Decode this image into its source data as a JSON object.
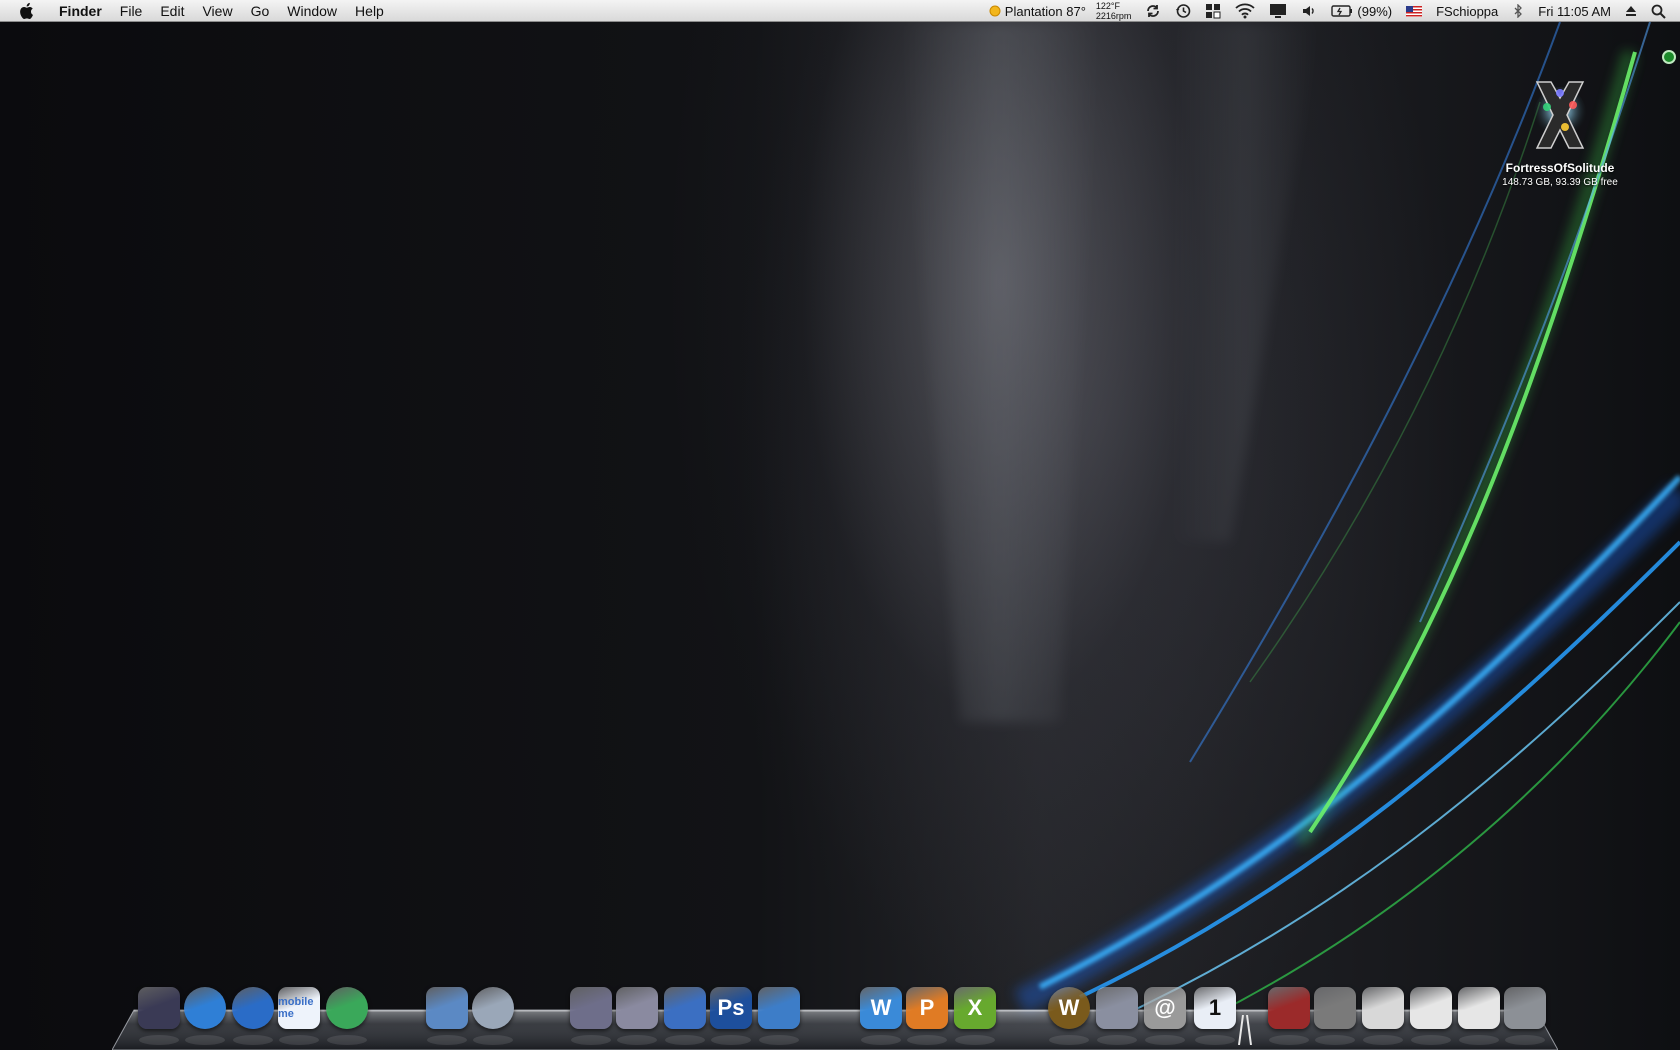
{
  "menubar": {
    "app_name": "Finder",
    "menus": [
      "File",
      "Edit",
      "View",
      "Go",
      "Window",
      "Help"
    ],
    "weather": "Plantation 87°",
    "temp_line1": "122°F",
    "temp_line2": "2216rpm",
    "battery": "(99%)",
    "user": "FSchioppa",
    "clock": "Fri 11:05 AM"
  },
  "desktop": {
    "volume_name": "FortressOfSolitude",
    "volume_info": "148.73 GB, 93.39 GB free"
  },
  "dock": {
    "items": [
      {
        "name": "apple-logo-app",
        "icon": "apple-icon",
        "color": "#3a3a55"
      },
      {
        "name": "globe-app",
        "icon": "globe-icon",
        "color": "#2f7fd6"
      },
      {
        "name": "safari",
        "icon": "compass-icon",
        "color": "#2a6cc7"
      },
      {
        "name": "mobileme",
        "icon": "cloud-icon",
        "color": "#eef3fb",
        "label": "mobile me"
      },
      {
        "name": "world-app",
        "icon": "earth-icon",
        "color": "#3aa85a"
      },
      {
        "name": "preview",
        "icon": "preview-icon",
        "color": "#5b89c4"
      },
      {
        "name": "itunes",
        "icon": "music-note-icon",
        "color": "#9aa7b8"
      },
      {
        "name": "keynote",
        "icon": "chart-icon",
        "color": "#6e6e8a"
      },
      {
        "name": "pen-app",
        "icon": "pen-icon",
        "color": "#8a8aa0"
      },
      {
        "name": "imovie",
        "icon": "clapper-icon",
        "color": "#3b6fc2"
      },
      {
        "name": "photoshop",
        "icon": "photoshop-icon",
        "color": "#1d4f9c",
        "label": "Ps"
      },
      {
        "name": "iphoto",
        "icon": "camera-icon",
        "color": "#3d7dc8"
      },
      {
        "name": "word",
        "icon": "word-icon",
        "color": "#3a8ad8",
        "label": "W"
      },
      {
        "name": "powerpoint",
        "icon": "powerpoint-icon",
        "color": "#e07b24",
        "label": "P"
      },
      {
        "name": "excel",
        "icon": "excel-icon",
        "color": "#67a92e",
        "label": "X"
      },
      {
        "name": "world-of-warcraft",
        "icon": "wow-icon",
        "color": "#7a5a1c",
        "label": "W"
      },
      {
        "name": "vmware",
        "icon": "vmware-icon",
        "color": "#8a8fa0"
      },
      {
        "name": "address-book",
        "icon": "at-sign-icon",
        "color": "#9a9a9a",
        "label": "@"
      },
      {
        "name": "ical",
        "icon": "calendar-icon",
        "color": "#e9eef6",
        "label": "1"
      },
      {
        "name": "florida-panthers",
        "icon": "panther-icon",
        "color": "#9b2a2a"
      },
      {
        "name": "login-window",
        "icon": "lock-user-icon",
        "color": "#7a7a7a"
      },
      {
        "name": "pdf-stack",
        "icon": "pdf-icon",
        "color": "#d8d8d8"
      },
      {
        "name": "documents-stack",
        "icon": "document-icon",
        "color": "#e6e6e6"
      },
      {
        "name": "downloads-stack",
        "icon": "download-icon",
        "color": "#e6e6e6"
      },
      {
        "name": "trash",
        "icon": "trash-icon",
        "color": "#8c9096"
      }
    ]
  }
}
